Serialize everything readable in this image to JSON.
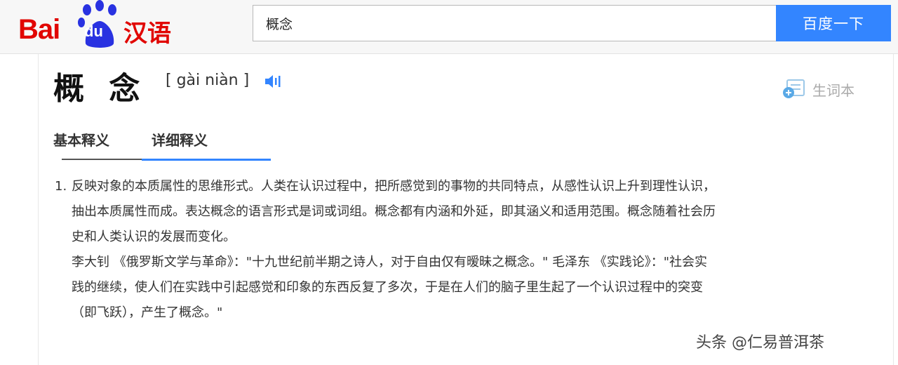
{
  "logo": {
    "part1": "Bai",
    "part2": "du",
    "part3": "汉语"
  },
  "search": {
    "value": "概念",
    "button_label": "百度一下"
  },
  "entry": {
    "word": "概 念",
    "pinyin": "[ gài niàn ]",
    "wordbook_label": "生词本"
  },
  "tabs": [
    {
      "label": "基本释义"
    },
    {
      "label": "详细释义"
    }
  ],
  "definitions": [
    {
      "number": "1.",
      "lines": [
        "反映对象的本质属性的思维形式。人类在认识过程中，把所感觉到的事物的共同特点，从感性认识上升到理性认识，",
        "抽出本质属性而成。表达概念的语言形式是词或词组。概念都有内涵和外延，即其涵义和适用范围。概念随着社会历",
        "史和人类认识的发展而变化。",
        "李大钊 《俄罗斯文学与革命》：\"十九世纪前半期之诗人，对于自由仅有暧昧之概念。\" 毛泽东 《实践论》：\"社会实",
        "践的继续，使人们在实践中引起感觉和印象的东西反复了多次，于是在人们的脑子里生起了一个认识过程中的突变",
        "（即飞跃），产生了概念。\""
      ]
    }
  ],
  "watermark": "头条 @仁易普洱茶",
  "colors": {
    "brand_red": "#e10602",
    "accent_blue": "#3385ff"
  }
}
